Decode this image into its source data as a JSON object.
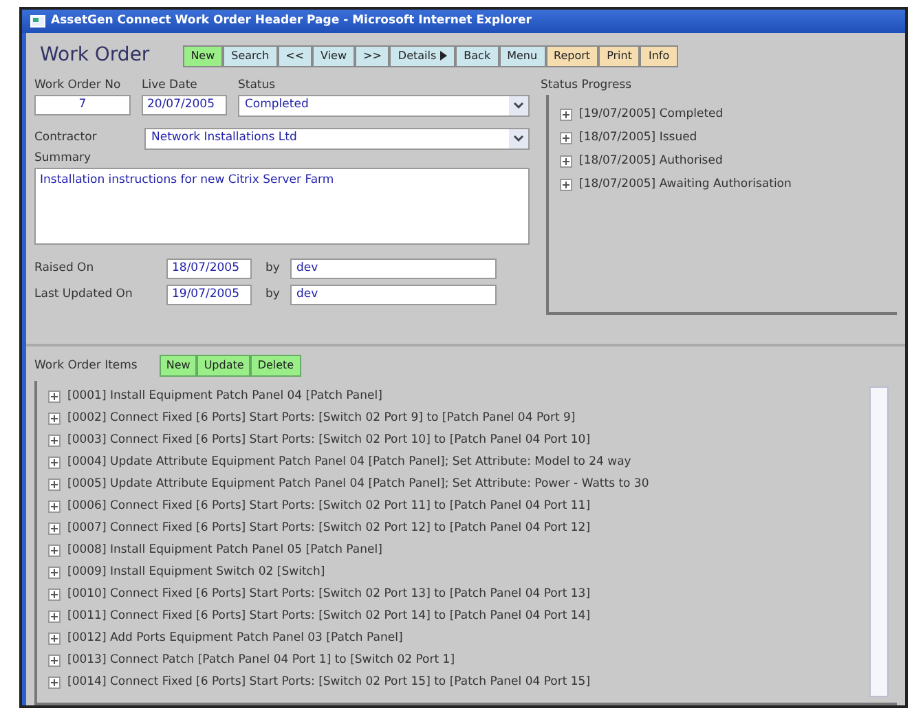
{
  "window": {
    "title": "AssetGen Connect Work Order Header Page - Microsoft Internet Explorer"
  },
  "page_title": "Work Order",
  "toolbar": [
    {
      "label": "New",
      "color": "#99ee88"
    },
    {
      "label": "Search",
      "color": "#cce6ee"
    },
    {
      "label": "<<",
      "color": "#cce6ee"
    },
    {
      "label": "View",
      "color": "#cce6ee"
    },
    {
      "label": ">>",
      "color": "#cce6ee"
    },
    {
      "label": "Details",
      "color": "#cce6ee",
      "caret": true
    },
    {
      "label": "Back",
      "color": "#cce6ee"
    },
    {
      "label": "Menu",
      "color": "#cce6ee"
    },
    {
      "label": "Report",
      "color": "#f5ddb0"
    },
    {
      "label": "Print",
      "color": "#f5ddb0"
    },
    {
      "label": "Info",
      "color": "#f5ddb0"
    }
  ],
  "form": {
    "work_order_no": {
      "label": "Work Order No",
      "value": "7"
    },
    "live_date": {
      "label": "Live Date",
      "value": "20/07/2005"
    },
    "status": {
      "label": "Status",
      "value": "Completed"
    },
    "contractor": {
      "label": "Contractor",
      "value": "Network Installations Ltd"
    },
    "summary": {
      "label": "Summary",
      "value": "Installation instructions for new Citrix Server Farm"
    },
    "raised_on": {
      "label": "Raised On",
      "value": "18/07/2005",
      "by_label": "by",
      "by": "dev"
    },
    "last_updated_on": {
      "label": "Last Updated On",
      "value": "19/07/2005",
      "by_label": "by",
      "by": "dev"
    }
  },
  "status_progress": {
    "label": "Status Progress",
    "items": [
      {
        "text": "[19/07/2005] Completed"
      },
      {
        "text": "[18/07/2005] Issued"
      },
      {
        "text": "[18/07/2005] Authorised"
      },
      {
        "text": "[18/07/2005] Awaiting Authorisation"
      }
    ]
  },
  "work_order_items": {
    "label": "Work Order Items",
    "buttons": [
      "New",
      "Update",
      "Delete"
    ],
    "items": [
      {
        "text": "[0001] Install Equipment Patch Panel 04 [Patch Panel]"
      },
      {
        "text": "[0002] Connect Fixed [6 Ports] Start Ports: [Switch 02 Port 9] to [Patch Panel 04 Port 9]"
      },
      {
        "text": "[0003] Connect Fixed [6 Ports] Start Ports: [Switch 02 Port 10] to [Patch Panel 04 Port 10]"
      },
      {
        "text": "[0004] Update Attribute Equipment Patch Panel 04 [Patch Panel]; Set Attribute: Model to 24 way"
      },
      {
        "text": "[0005] Update Attribute Equipment Patch Panel 04 [Patch Panel]; Set Attribute: Power - Watts to 30"
      },
      {
        "text": "[0006] Connect Fixed [6 Ports] Start Ports: [Switch 02 Port 11] to [Patch Panel 04 Port 11]"
      },
      {
        "text": "[0007] Connect Fixed [6 Ports] Start Ports: [Switch 02 Port 12] to [Patch Panel 04 Port 12]"
      },
      {
        "text": "[0008] Install Equipment Patch Panel 05 [Patch Panel]"
      },
      {
        "text": "[0009] Install Equipment Switch 02 [Switch]"
      },
      {
        "text": "[0010] Connect Fixed [6 Ports] Start Ports: [Switch 02 Port 13] to [Patch Panel 04 Port 13]"
      },
      {
        "text": "[0011] Connect Fixed [6 Ports] Start Ports: [Switch 02 Port 14] to [Patch Panel 04 Port 14]"
      },
      {
        "text": "[0012] Add Ports Equipment Patch Panel 03 [Patch Panel]"
      },
      {
        "text": "[0013] Connect Patch [Patch Panel 04 Port 1] to [Switch 02 Port 1]"
      },
      {
        "text": "[0014] Connect Fixed [6 Ports] Start Ports: [Switch 02 Port 15] to [Patch Panel 04 Port 15]"
      }
    ]
  }
}
